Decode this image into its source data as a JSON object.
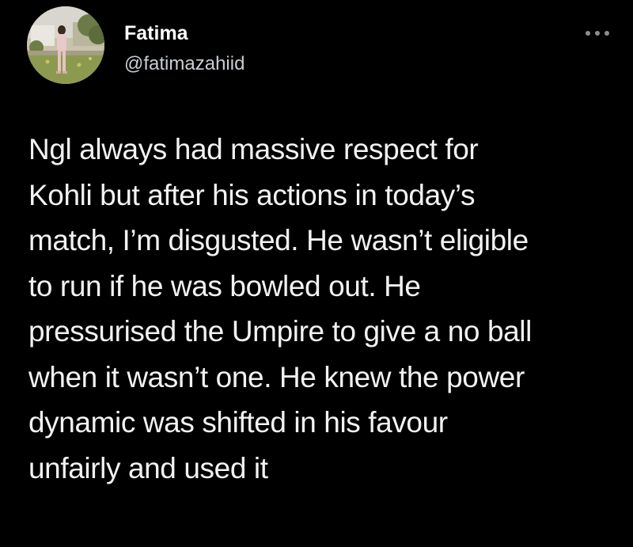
{
  "tweet": {
    "author": {
      "display_name": "Fatima",
      "handle": "@fatimazahiid",
      "avatar": "profile-photo"
    },
    "more_icon": "more-horizontal-icon",
    "text_lines": [
      "Ngl always had massive respect for",
      "Kohli but after his actions in today’s",
      "match, I’m disgusted. He wasn’t eligible",
      "to run if he was bowled out. He",
      "pressurised the Umpire to give a no ball",
      "when it wasn’t one. He knew the power",
      "dynamic was shifted in his favour",
      "unfairly and used it"
    ]
  },
  "colors": {
    "background": "#000000",
    "text": "#f2f2f2",
    "handle": "#c9cdd1"
  }
}
